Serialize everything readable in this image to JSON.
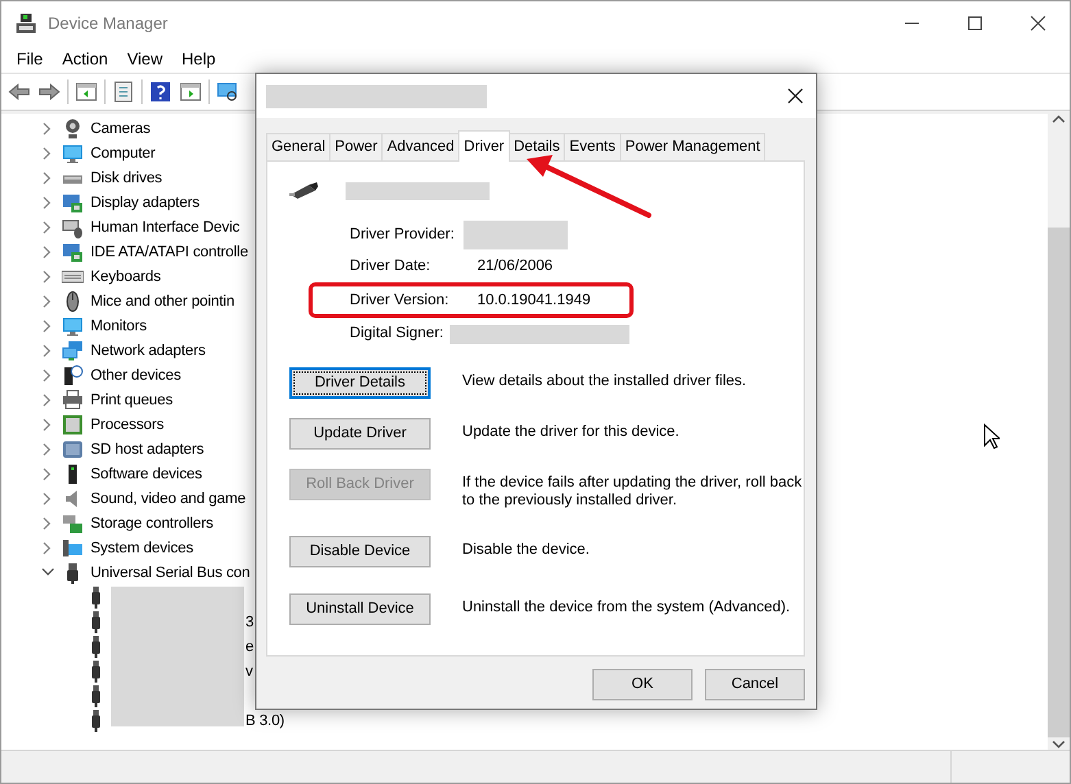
{
  "window": {
    "title": "Device Manager"
  },
  "menu": [
    "File",
    "Action",
    "View",
    "Help"
  ],
  "tree": {
    "items": [
      {
        "label": "Cameras",
        "expanded": false
      },
      {
        "label": "Computer",
        "expanded": false
      },
      {
        "label": "Disk drives",
        "expanded": false
      },
      {
        "label": "Display adapters",
        "expanded": false
      },
      {
        "label": "Human Interface Devic",
        "expanded": false
      },
      {
        "label": "IDE ATA/ATAPI controlle",
        "expanded": false
      },
      {
        "label": "Keyboards",
        "expanded": false
      },
      {
        "label": "Mice and other pointin",
        "expanded": false
      },
      {
        "label": "Monitors",
        "expanded": false
      },
      {
        "label": "Network adapters",
        "expanded": false
      },
      {
        "label": "Other devices",
        "expanded": false
      },
      {
        "label": "Print queues",
        "expanded": false
      },
      {
        "label": "Processors",
        "expanded": false
      },
      {
        "label": "SD host adapters",
        "expanded": false
      },
      {
        "label": "Software devices",
        "expanded": false
      },
      {
        "label": "Sound, video and game",
        "expanded": false
      },
      {
        "label": "Storage controllers",
        "expanded": false
      },
      {
        "label": "System devices",
        "expanded": false
      },
      {
        "label": "Universal Serial Bus con",
        "expanded": true,
        "children_redacted": true,
        "children": [
          {
            "kind": "usb-device"
          },
          {
            "kind": "usb-device",
            "label": "3"
          },
          {
            "kind": "usb-device",
            "label": "e"
          },
          {
            "kind": "usb-device",
            "label": "v"
          },
          {
            "kind": "usb-device"
          },
          {
            "kind": "usb-device",
            "label": "B 3.0)"
          }
        ]
      }
    ]
  },
  "dialog": {
    "title_redacted": true,
    "tabs": [
      {
        "label": "General",
        "selected": false
      },
      {
        "label": "Power",
        "selected": false
      },
      {
        "label": "Advanced",
        "selected": false
      },
      {
        "label": "Driver",
        "selected": true
      },
      {
        "label": "Details",
        "selected": false
      },
      {
        "label": "Events",
        "selected": false
      },
      {
        "label": "Power Management",
        "selected": false
      }
    ],
    "device_name_redacted": true,
    "fields": [
      {
        "label": "Driver Provider:",
        "redacted": true,
        "highlighted": false
      },
      {
        "label": "Driver Date:",
        "value": "21/06/2006",
        "highlighted": false
      },
      {
        "label": "Driver Version:",
        "value": "10.0.19041.1949",
        "highlighted": true
      },
      {
        "label": "Digital Signer:",
        "redacted": true,
        "highlighted": false
      }
    ],
    "actions": [
      {
        "button": "Driver Details",
        "description": "View details about the installed driver files.",
        "focused": true,
        "disabled": false
      },
      {
        "button": "Update Driver",
        "description": "Update the driver for this device.",
        "focused": false,
        "disabled": false
      },
      {
        "button": "Roll Back Driver",
        "description": "If the device fails after updating the driver, roll back to the previously installed driver.",
        "focused": false,
        "disabled": true
      },
      {
        "button": "Disable Device",
        "description": "Disable the device.",
        "focused": false,
        "disabled": false
      },
      {
        "button": "Uninstall Device",
        "description": "Uninstall the device from the system (Advanced).",
        "focused": false,
        "disabled": false
      }
    ],
    "footer_buttons": [
      "OK",
      "Cancel"
    ]
  },
  "annotations": [
    {
      "kind": "arrow"
    }
  ]
}
